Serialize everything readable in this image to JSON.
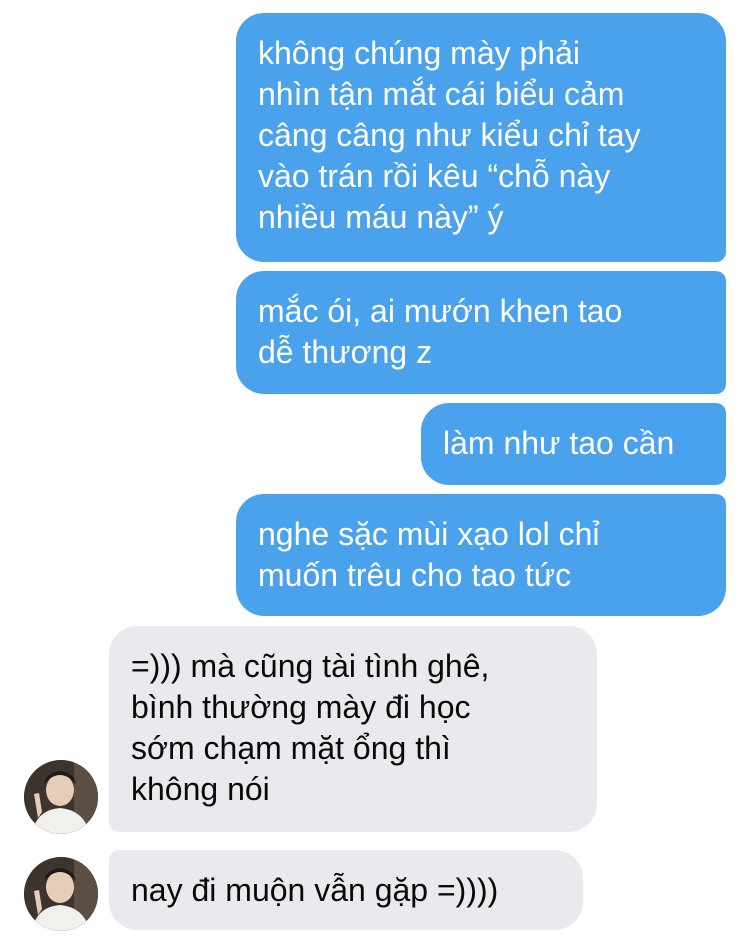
{
  "messages": [
    {
      "sender": "me",
      "text": "không chúng mày phải\nnhìn tận mắt cái biểu cảm\ncâng câng như kiểu chỉ tay\nvào trán rồi kêu “chỗ này\nnhiều máu này” ý"
    },
    {
      "sender": "me",
      "text": "mắc ói, ai mướn khen tao\ndễ thương z"
    },
    {
      "sender": "me",
      "text": "làm như tao cần"
    },
    {
      "sender": "me",
      "text": "nghe sặc mùi xạo lol chỉ\nmuốn trêu cho tao tức"
    },
    {
      "sender": "other",
      "text": "=))) mà cũng tài tình ghê,\nbình thường mày đi học\nsớm chạm mặt ổng thì\nkhông nói"
    },
    {
      "sender": "other",
      "text": "nay đi muộn vẫn gặp =))))"
    }
  ],
  "colors": {
    "outgoing_bubble": "#4aa2ec",
    "incoming_bubble": "#e9eaee"
  },
  "icons": {
    "contact_avatar": "avatar-icon"
  }
}
